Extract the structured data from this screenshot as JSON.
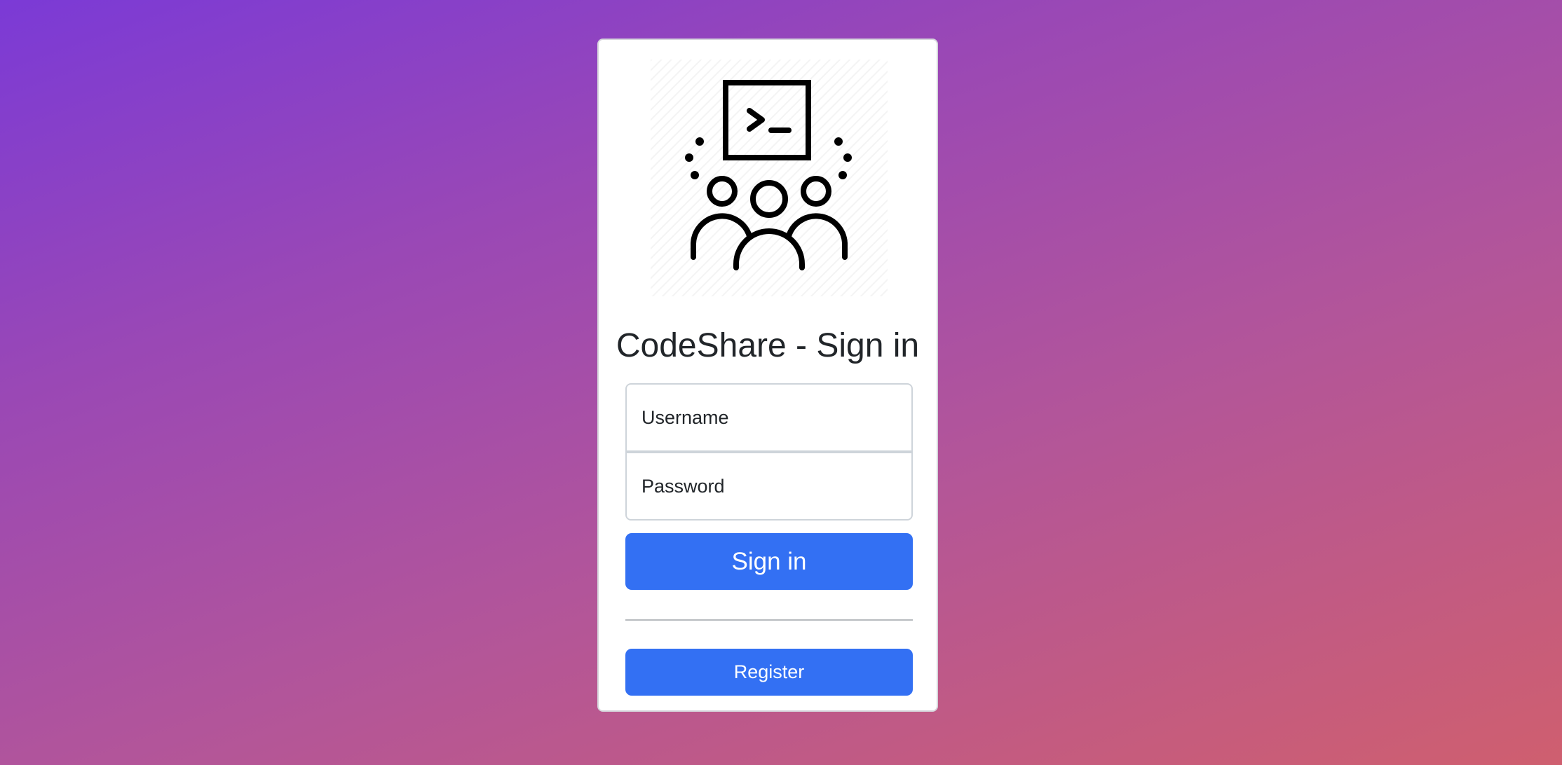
{
  "app": {
    "logo_icon": "terminal-team-icon",
    "title": "CodeShare - Sign in"
  },
  "form": {
    "username_placeholder": "Username",
    "password_placeholder": "Password",
    "signin_label": "Sign in",
    "register_label": "Register"
  },
  "colors": {
    "primary": "#3370f3",
    "background_start": "#7b3ad6",
    "background_end": "#cf5f6f"
  }
}
